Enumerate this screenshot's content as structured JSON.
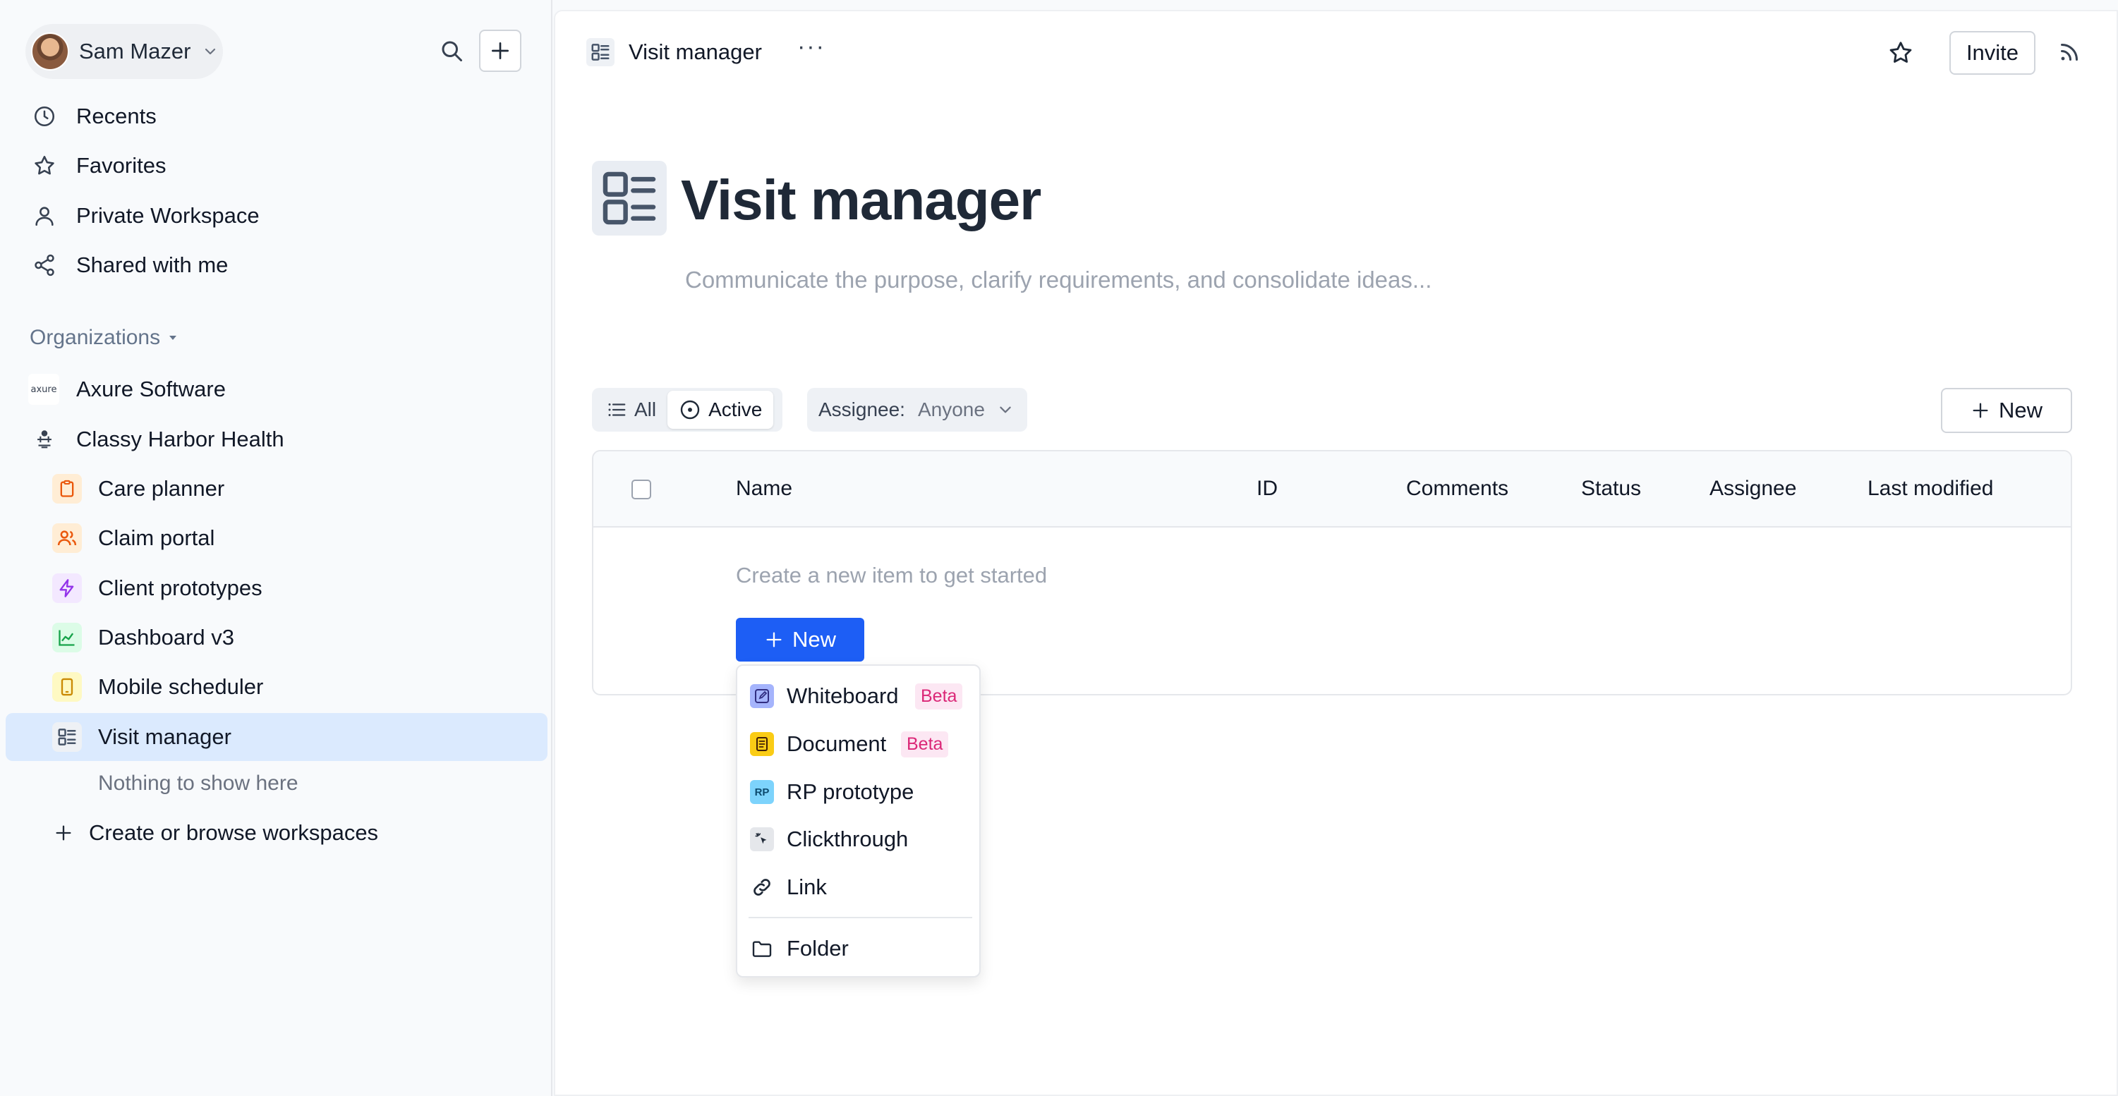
{
  "user": {
    "name": "Sam Mazer"
  },
  "nav": {
    "recents": "Recents",
    "favorites": "Favorites",
    "private": "Private Workspace",
    "shared": "Shared with me"
  },
  "organizations": {
    "header": "Organizations",
    "orgs": [
      "Axure Software",
      "Classy Harbor Health"
    ],
    "workspaces": [
      "Care planner",
      "Claim portal",
      "Client prototypes",
      "Dashboard v3",
      "Mobile scheduler",
      "Visit manager"
    ],
    "empty": "Nothing to show here",
    "create": "Create or browse workspaces",
    "axure_logo_text": "axure"
  },
  "topbar": {
    "title": "Visit manager",
    "more": "···",
    "invite": "Invite"
  },
  "page": {
    "title": "Visit manager",
    "description": "Communicate the purpose, clarify requirements, and consolidate ideas..."
  },
  "filters": {
    "all": "All",
    "active": "Active",
    "assignee_label": "Assignee:",
    "assignee_value": "Anyone",
    "new": "New"
  },
  "table": {
    "columns": [
      "Name",
      "ID",
      "Comments",
      "Status",
      "Assignee",
      "Last modified"
    ],
    "empty_hint": "Create a new item to get started",
    "new": "New"
  },
  "menu": {
    "items": [
      "Whiteboard",
      "Document",
      "RP prototype",
      "Clickthrough",
      "Link",
      "Folder"
    ],
    "beta": "Beta",
    "rp_badge": "RP"
  },
  "colors": {
    "primary": "#1d5ef5",
    "selected": "#dbeafe",
    "beta_text": "#db2777",
    "beta_bg": "#fce7f3"
  }
}
